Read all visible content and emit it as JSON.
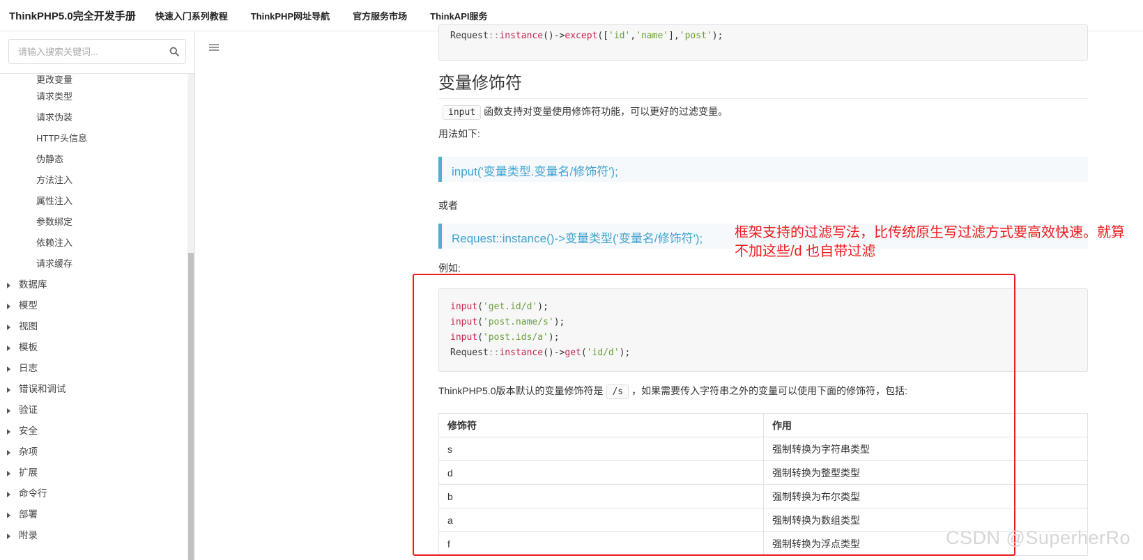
{
  "header": {
    "brand": "ThinkPHP5.0完全开发手册",
    "nav": [
      "快速入门系列教程",
      "ThinkPHP网址导航",
      "官方服务市场",
      "ThinkAPI服务"
    ]
  },
  "sidebar": {
    "search_placeholder": "请输入搜索关键词...",
    "sub_items": [
      "更改变量",
      "请求类型",
      "请求伪装",
      "HTTP头信息",
      "伪静态",
      "方法注入",
      "属性注入",
      "参数绑定",
      "依赖注入",
      "请求缓存"
    ],
    "top_items": [
      "数据库",
      "模型",
      "视图",
      "模板",
      "日志",
      "错误和调试",
      "验证",
      "安全",
      "杂项",
      "扩展",
      "命令行",
      "部署",
      "附录"
    ]
  },
  "content": {
    "code_top": {
      "cls": "Request",
      "sep": "::",
      "method": "instance",
      "arrow": "()->",
      "call": "except",
      "args_open": "([",
      "a1": "'id'",
      "comma1": ",",
      "a2": "'name'",
      "mid": "],",
      "a3": "'post'",
      "close": ");"
    },
    "heading": "变量修饰符",
    "intro_code": "input",
    "intro_text": "函数支持对变量使用修饰符功能，可以更好的过滤变量。",
    "usage_label": "用法如下:",
    "quote1": "input('变量类型.变量名/修饰符');",
    "or_text": "或者",
    "quote2": "Request::instance()->变量类型('变量名/修饰符');",
    "example_label": "例如:",
    "code_lines": [
      {
        "fn": "input",
        "open": "(",
        "str": "'get.id/d'",
        "close": ");"
      },
      {
        "fn": "input",
        "open": "(",
        "str": "'post.name/s'",
        "close": ");"
      },
      {
        "fn": "input",
        "open": "(",
        "str": "'post.ids/a'",
        "close": ");"
      }
    ],
    "code_last": {
      "cls": "Request",
      "sep": "::",
      "method": "instance",
      "arrow": "()->",
      "call": "get",
      "open": "(",
      "str": "'id/d'",
      "close": ");"
    },
    "default_text_before": "ThinkPHP5.0版本默认的变量修饰符是",
    "default_code": "/s",
    "default_text_after": "，如果需要传入字符串之外的变量可以使用下面的修饰符，包括:",
    "table": {
      "headers": [
        "修饰符",
        "作用"
      ],
      "rows": [
        [
          "s",
          "强制转换为字符串类型"
        ],
        [
          "d",
          "强制转换为整型类型"
        ],
        [
          "b",
          "强制转换为布尔类型"
        ],
        [
          "a",
          "强制转换为数组类型"
        ],
        [
          "f",
          "强制转换为浮点类型"
        ]
      ]
    }
  },
  "annotation": {
    "text": "框架支持的过滤写法，比传统原生写过滤方式要高效快速。就算不加这些/d 也自带过滤",
    "color": "#ee1c1c"
  },
  "watermark": "CSDN @SuperherRo",
  "colors": {
    "accent": "#42a3cf",
    "quote_border": "#4fb1cf",
    "code_fn": "#c7254e",
    "code_str": "#689f38"
  }
}
